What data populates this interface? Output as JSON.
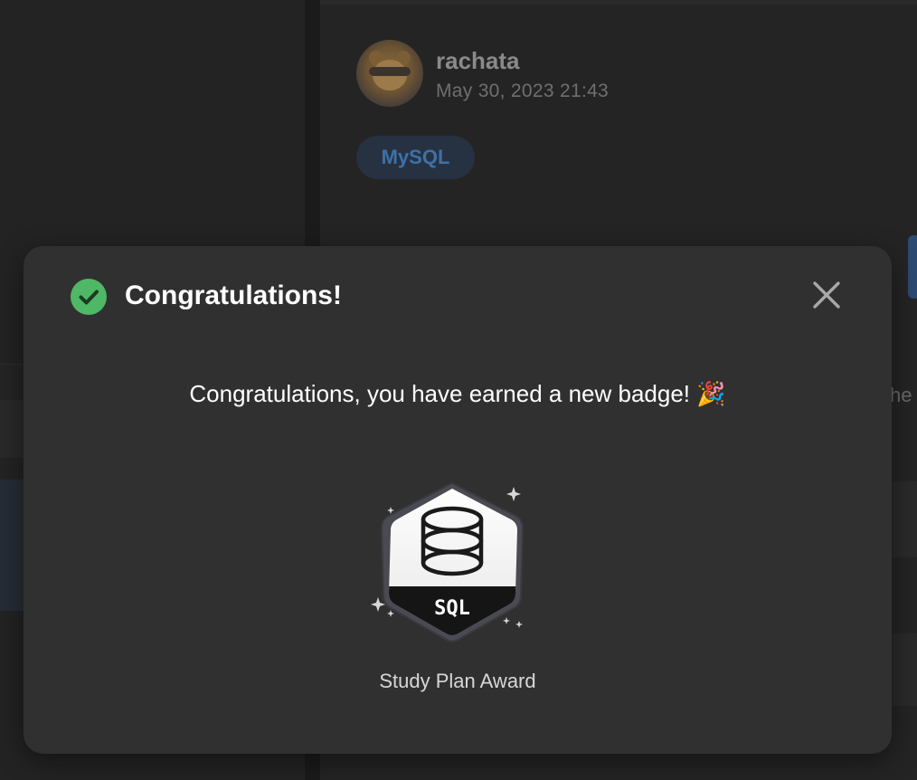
{
  "post": {
    "author": "rachata",
    "date": "May 30, 2023 21:43",
    "tag": "MySQL",
    "peek_text": "he"
  },
  "modal": {
    "title": "Congratulations!",
    "message": "Congratulations, you have earned a new badge! 🎉",
    "badge_label": "SQL",
    "badge_name": "Study Plan Award",
    "success_color": "#4fb866"
  },
  "icons": {
    "status": "check-circle-icon",
    "close": "close-icon",
    "badge": "sql-database-badge-icon"
  }
}
